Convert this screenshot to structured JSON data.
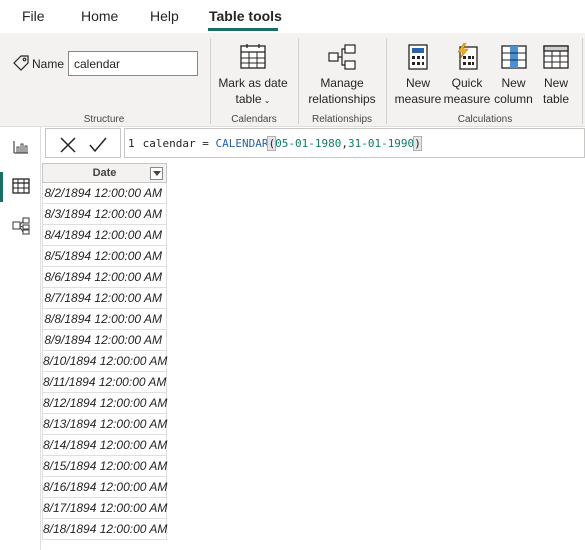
{
  "menu": {
    "tabs": [
      "File",
      "Home",
      "Help",
      "Table tools"
    ],
    "active": "Table tools"
  },
  "ribbon": {
    "structure": {
      "name_label": "Name",
      "name_value": "calendar",
      "group_label": "Structure"
    },
    "calendars": {
      "mark_line1": "Mark as date",
      "mark_line2": "table",
      "group_label": "Calendars"
    },
    "relationships": {
      "manage_line1": "Manage",
      "manage_line2": "relationships",
      "group_label": "Relationships"
    },
    "calculations": {
      "new_measure": [
        "New",
        "measure"
      ],
      "quick_measure": [
        "Quick",
        "measure"
      ],
      "new_column": [
        "New",
        "column"
      ],
      "new_table": [
        "New",
        "table"
      ],
      "group_label": "Calculations"
    }
  },
  "formula": {
    "line_number": "1",
    "table_name": "calendar",
    "operator": "=",
    "function": "CALENDAR",
    "open_paren": "(",
    "arg1": "05-01-1980",
    "comma": ",",
    "arg2": "31-01-1990",
    "close_paren": ")"
  },
  "table": {
    "column_header": "Date",
    "rows": [
      "8/2/1894 12:00:00 AM",
      "8/3/1894 12:00:00 AM",
      "8/4/1894 12:00:00 AM",
      "8/5/1894 12:00:00 AM",
      "8/6/1894 12:00:00 AM",
      "8/7/1894 12:00:00 AM",
      "8/8/1894 12:00:00 AM",
      "8/9/1894 12:00:00 AM",
      "8/10/1894 12:00:00 AM",
      "8/11/1894 12:00:00 AM",
      "8/12/1894 12:00:00 AM",
      "8/13/1894 12:00:00 AM",
      "8/14/1894 12:00:00 AM",
      "8/15/1894 12:00:00 AM",
      "8/16/1894 12:00:00 AM",
      "8/17/1894 12:00:00 AM",
      "8/18/1894 12:00:00 AM"
    ]
  },
  "colors": {
    "accent": "#1a6e63",
    "function": "#2b63a6",
    "argument": "#0e7a6a"
  }
}
